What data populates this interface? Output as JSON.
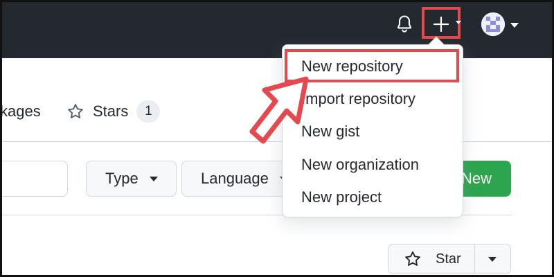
{
  "header": {
    "bell_icon": "bell-icon",
    "plus_icon": "plus-icon",
    "avatar_icon": "avatar-identicon"
  },
  "tabs": {
    "packages_label": "kages",
    "stars_label": "Stars",
    "stars_count": "1"
  },
  "filters": {
    "type_label": "Type",
    "language_label": "Language",
    "new_label": "New"
  },
  "star_button": {
    "label": "Star"
  },
  "dropdown": {
    "items": [
      {
        "label": "New repository"
      },
      {
        "label": "Import repository"
      },
      {
        "label": "New gist"
      },
      {
        "label": "New organization"
      },
      {
        "label": "New project"
      }
    ]
  },
  "colors": {
    "header_bg": "#24292f",
    "annotation": "#e5484d",
    "primary_green": "#2da44e"
  }
}
